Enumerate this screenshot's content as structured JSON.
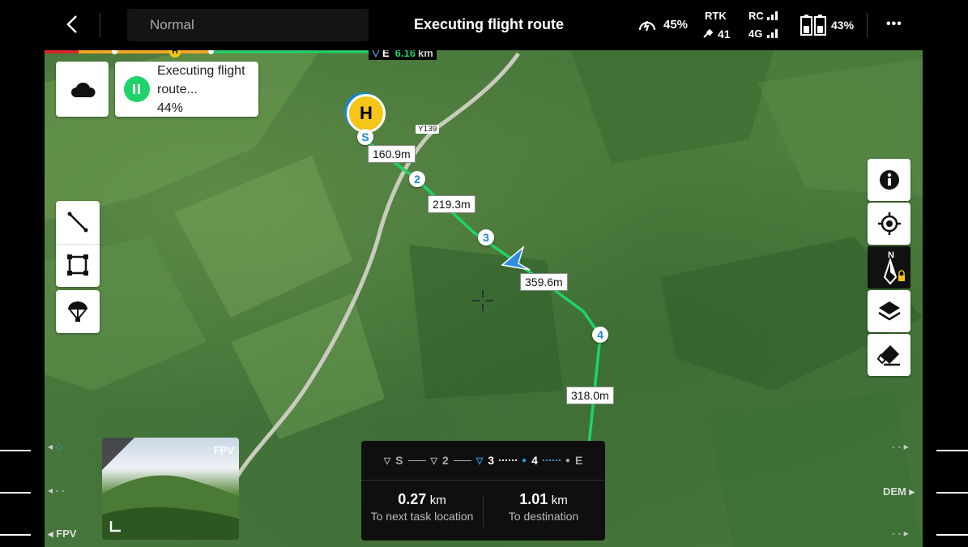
{
  "header": {
    "mode_label": "Normal",
    "title": "Executing flight route",
    "speed_pct": "45%",
    "rtk_label": "RTK",
    "rtk_count": "41",
    "rc_label": "RC",
    "g4_label": "4G",
    "battery_pct": "43%",
    "more": "•••"
  },
  "progress_bar": {
    "home_label": "H",
    "end_marker": "E",
    "distance": "6.16",
    "distance_unit": "km"
  },
  "status_card": {
    "line1": "Executing flight",
    "line2": "route...",
    "percent": "44%"
  },
  "map": {
    "road_label": "Y139",
    "home_label": "H",
    "waypoints": [
      "S",
      "2",
      "3",
      "4"
    ],
    "segment_labels": [
      "160.9m",
      "219.3m",
      "359.6m",
      "318.0m"
    ]
  },
  "fpv": {
    "label": "FPV"
  },
  "left_edge": {
    "fpv_label": "FPV"
  },
  "right_edge": {
    "dem_label": "DEM"
  },
  "route_panel": {
    "steps": [
      "S",
      "2",
      "3",
      "4",
      "E"
    ],
    "next_value": "0.27",
    "next_unit": "km",
    "next_label": "To next task location",
    "dest_value": "1.01",
    "dest_unit": "km",
    "dest_label": "To destination"
  },
  "colors": {
    "route": "#1fd36a",
    "accent_blue": "#1a86d0",
    "home_yellow": "#f5c518"
  }
}
